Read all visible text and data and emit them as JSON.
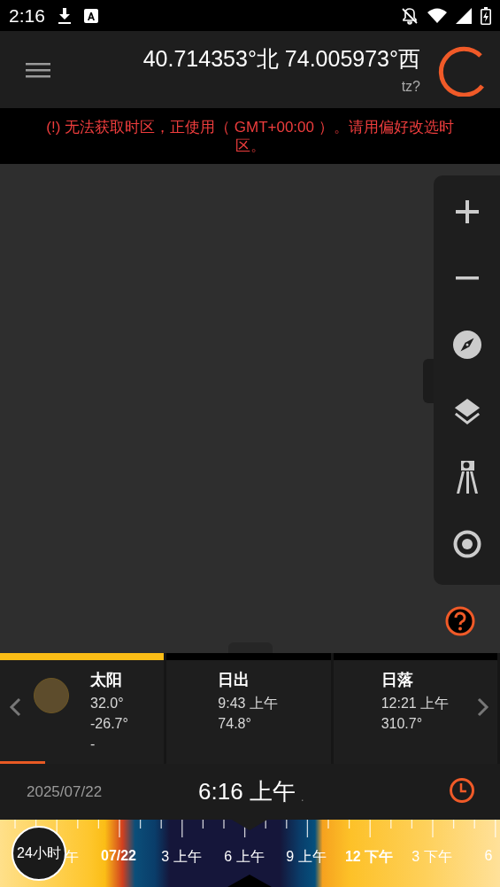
{
  "status_bar": {
    "time": "2:16"
  },
  "toolbar": {
    "coordinates": "40.714353°北  74.005973°西",
    "timezone": "tz?"
  },
  "warning": {
    "text": "(!) 无法获取时区，正使用（ GMT+00:00 ）。请用偏好改选时区。"
  },
  "cards": [
    {
      "kind": "sun",
      "title": "太阳",
      "lines": [
        "32.0°",
        "-26.7°",
        "-"
      ],
      "selected": true
    },
    {
      "kind": "text",
      "title": "日出",
      "lines": [
        "9:43 上午",
        "74.8°"
      ],
      "selected": false
    },
    {
      "kind": "text",
      "title": "日落",
      "lines": [
        "12:21 上午",
        "310.7°"
      ],
      "selected": false
    }
  ],
  "progress": {
    "level": 0.09
  },
  "time_bar": {
    "date": "2025/07/22",
    "time": "6:16 上午",
    "mark": "."
  },
  "timeline": {
    "mode_button": "24小时",
    "labels": [
      {
        "text": "午",
        "bold": false
      },
      {
        "text": "07/22",
        "bold": true
      },
      {
        "text": "3 上午",
        "bold": false
      },
      {
        "text": "6 上午",
        "bold": false
      },
      {
        "text": "9 上午",
        "bold": false
      },
      {
        "text": "12 下午",
        "bold": true
      },
      {
        "text": "3 下午",
        "bold": false
      },
      {
        "text": "6",
        "bold": false
      }
    ]
  }
}
